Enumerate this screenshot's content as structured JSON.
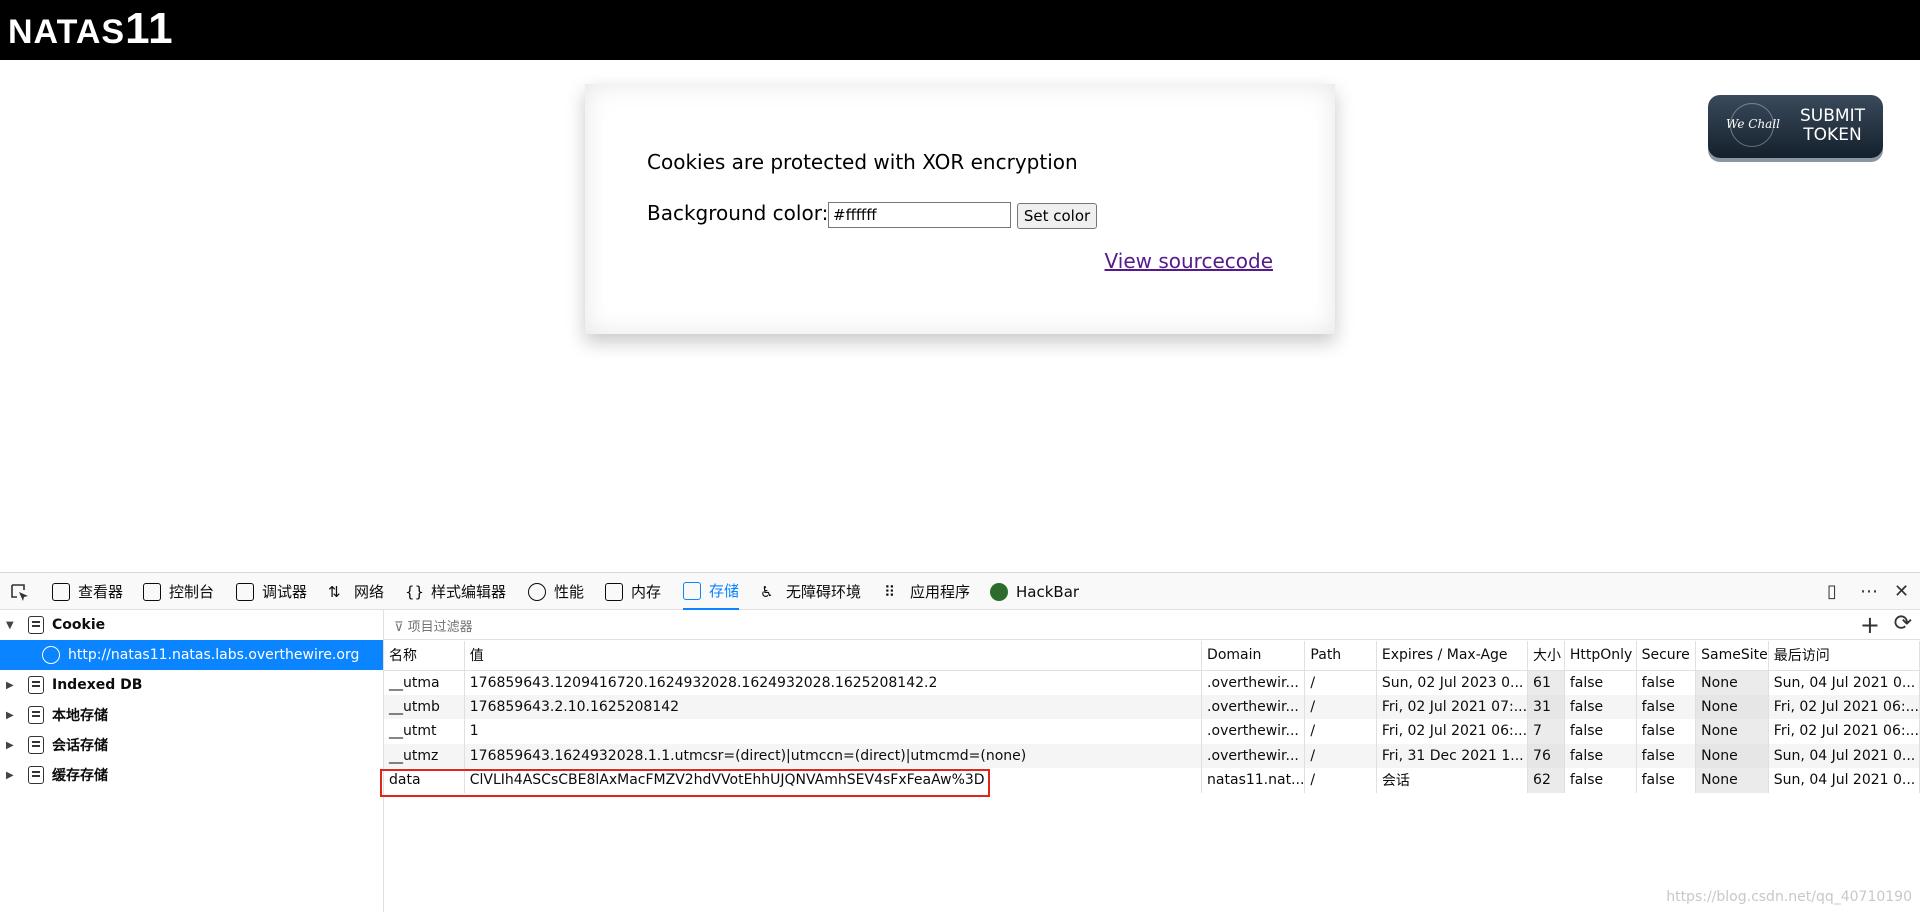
{
  "page": {
    "title_prefix": "NATAS",
    "title_number": "11",
    "message": "Cookies are protected with XOR encryption",
    "bg_label": "Background color:",
    "bg_value": "#ffffff",
    "set_button": "Set color",
    "source_link": "View sourcecode",
    "token_brand": "We Chall",
    "token_line1": "SUBMIT",
    "token_line2": "TOKEN"
  },
  "devtools": {
    "tabs": [
      {
        "label": "查看器",
        "icon": "inspector-icon"
      },
      {
        "label": "控制台",
        "icon": "console-icon"
      },
      {
        "label": "调试器",
        "icon": "debugger-icon"
      },
      {
        "label": "网络",
        "icon": "network-icon"
      },
      {
        "label": "样式编辑器",
        "icon": "style-editor-icon"
      },
      {
        "label": "性能",
        "icon": "performance-icon"
      },
      {
        "label": "内存",
        "icon": "memory-icon"
      },
      {
        "label": "存储",
        "icon": "storage-icon",
        "active": true
      },
      {
        "label": "无障碍环境",
        "icon": "accessibility-icon"
      },
      {
        "label": "应用程序",
        "icon": "application-icon"
      },
      {
        "label": "HackBar",
        "icon": "hackbar-icon"
      }
    ],
    "sidebar": {
      "cookie": "Cookie",
      "cookie_host": "http://natas11.natas.labs.overthewire.org",
      "indexed_db": "Indexed DB",
      "local_storage": "本地存储",
      "session_storage": "会话存储",
      "cache_storage": "缓存存储"
    },
    "filter_placeholder": "项目过滤器",
    "columns": [
      "名称",
      "值",
      "Domain",
      "Path",
      "Expires / Max-Age",
      "大小",
      "HttpOnly",
      "Secure",
      "SameSite",
      "最后访问"
    ],
    "rows": [
      [
        "__utma",
        "176859643.1209416720.1624932028.1624932028.1625208142.2",
        ".overthewir...",
        "/",
        "Sun, 02 Jul 2023 0...",
        "61",
        "false",
        "false",
        "None",
        "Sun, 04 Jul 2021 0..."
      ],
      [
        "__utmb",
        "176859643.2.10.1625208142",
        ".overthewir...",
        "/",
        "Fri, 02 Jul 2021 07:...",
        "31",
        "false",
        "false",
        "None",
        "Fri, 02 Jul 2021 06:..."
      ],
      [
        "__utmt",
        "1",
        ".overthewir...",
        "/",
        "Fri, 02 Jul 2021 06:...",
        "7",
        "false",
        "false",
        "None",
        "Fri, 02 Jul 2021 06:..."
      ],
      [
        "__utmz",
        "176859643.1624932028.1.1.utmcsr=(direct)|utmccn=(direct)|utmcmd=(none)",
        ".overthewir...",
        "/",
        "Fri, 31 Dec 2021 1...",
        "76",
        "false",
        "false",
        "None",
        "Sun, 04 Jul 2021 0..."
      ],
      [
        "data",
        "ClVLIh4ASCsCBE8lAxMacFMZV2hdVVotEhhUJQNVAmhSEV4sFxFeaAw%3D",
        "natas11.nat...",
        "/",
        "会话",
        "62",
        "false",
        "false",
        "None",
        "Sun, 04 Jul 2021 0..."
      ]
    ],
    "highlight_color": "#e1251b",
    "accent_color": "#0a84ff"
  },
  "watermark": "https://blog.csdn.net/qq_40710190"
}
